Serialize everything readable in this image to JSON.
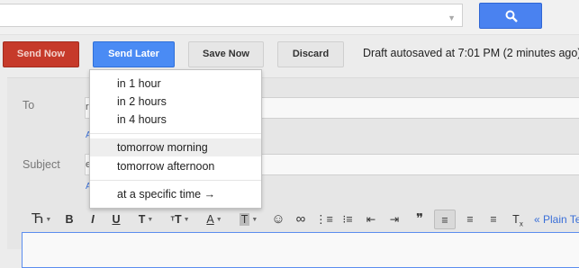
{
  "search": {
    "dropdown_icon": "chevron-down-icon",
    "button_icon": "search-icon"
  },
  "toolbar": {
    "send_now": "Send Now",
    "send_later": "Send Later",
    "save_now": "Save Now",
    "discard": "Discard",
    "autosave_text": "Draft autosaved at 7:01 PM (2 minutes ago)"
  },
  "compose": {
    "to_label": "To",
    "subject_label": "Subject"
  },
  "send_later_menu": {
    "items": [
      "in 1 hour",
      "in 2 hours",
      "in 4 hours",
      "tomorrow morning",
      "tomorrow afternoon",
      "at a specific time →"
    ],
    "highlighted": "tomorrow morning"
  },
  "format_toolbar": {
    "plain_text_link": "« Plain Text",
    "buttons": [
      {
        "icon": "font-family-icon",
        "glyph": "Ћ"
      },
      {
        "icon": "bold-icon",
        "glyph": "B"
      },
      {
        "icon": "italic-icon",
        "glyph": "I"
      },
      {
        "icon": "underline-icon",
        "glyph": "U"
      },
      {
        "icon": "font-size-icon",
        "glyph": "T"
      },
      {
        "icon": "text-size-icon",
        "glyph": "ᵀT"
      },
      {
        "icon": "text-color-icon",
        "glyph": "A"
      },
      {
        "icon": "highlight-color-icon",
        "glyph": "T"
      },
      {
        "icon": "emoji-icon",
        "glyph": "☺"
      },
      {
        "icon": "link-icon",
        "glyph": "∞"
      },
      {
        "icon": "numbered-list-icon",
        "glyph": "⋮≡"
      },
      {
        "icon": "bulleted-list-icon",
        "glyph": "⁝≡"
      },
      {
        "icon": "indent-less-icon",
        "glyph": "⇤"
      },
      {
        "icon": "indent-more-icon",
        "glyph": "⇥"
      },
      {
        "icon": "quote-icon",
        "glyph": "❞"
      },
      {
        "icon": "align-left-icon",
        "glyph": "≡"
      },
      {
        "icon": "align-center-icon",
        "glyph": "≡"
      },
      {
        "icon": "align-right-icon",
        "glyph": "≡"
      },
      {
        "icon": "remove-formatting-icon",
        "glyph": "Tₓ"
      }
    ]
  },
  "colors": {
    "send_button": "#c63a2a",
    "send_later_button": "#4a8bf4",
    "search_button": "#4a82f0",
    "link": "#3a6fd8"
  }
}
